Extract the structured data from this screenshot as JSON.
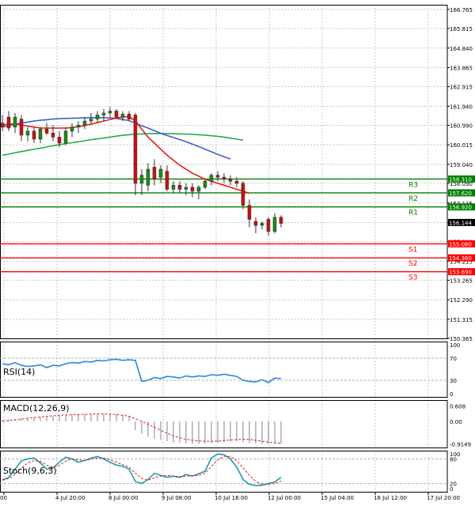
{
  "chart_data": [
    {
      "type": "candlestick",
      "panel": "price",
      "x_tick_labels": [
        "00",
        "4 Jul 20:00",
        "8 Jul 00:00",
        "9 Jul 08:00",
        "10 Jul 16:00",
        "12 Jul 00:00",
        "15 Jul 04:00",
        "16 Jul 12:00",
        "17 Jul 20:00"
      ],
      "y_tick_labels": [
        "166.765",
        "165.815",
        "164.840",
        "163.865",
        "162.915",
        "161.940",
        "160.990",
        "160.015",
        "159.040",
        "158.090",
        "157.115",
        "156.140",
        "155.190",
        "154.215",
        "153.265",
        "152.290",
        "151.315",
        "150.365"
      ],
      "ylim": [
        150.365,
        167.0
      ],
      "current_price": "156.144",
      "candles": [
        {
          "o": 161.1,
          "h": 161.5,
          "l": 160.7,
          "c": 160.9
        },
        {
          "o": 161.4,
          "h": 161.7,
          "l": 160.7,
          "c": 160.85
        },
        {
          "o": 160.9,
          "h": 161.6,
          "l": 160.6,
          "c": 161.4
        },
        {
          "o": 161.3,
          "h": 161.5,
          "l": 160.2,
          "c": 160.5
        },
        {
          "o": 160.5,
          "h": 160.9,
          "l": 160.2,
          "c": 160.7
        },
        {
          "o": 160.7,
          "h": 160.9,
          "l": 160.1,
          "c": 160.3
        },
        {
          "o": 160.3,
          "h": 160.9,
          "l": 160.1,
          "c": 160.8
        },
        {
          "o": 160.8,
          "h": 161.1,
          "l": 160.5,
          "c": 160.6
        },
        {
          "o": 160.6,
          "h": 161.0,
          "l": 160.2,
          "c": 160.4
        },
        {
          "o": 160.4,
          "h": 160.7,
          "l": 159.9,
          "c": 160.1
        },
        {
          "o": 160.1,
          "h": 160.9,
          "l": 160.0,
          "c": 160.7
        },
        {
          "o": 160.7,
          "h": 161.1,
          "l": 160.4,
          "c": 160.9
        },
        {
          "o": 160.9,
          "h": 161.2,
          "l": 160.6,
          "c": 161.0
        },
        {
          "o": 161.0,
          "h": 161.4,
          "l": 160.8,
          "c": 161.2
        },
        {
          "o": 161.2,
          "h": 161.6,
          "l": 161.0,
          "c": 161.3
        },
        {
          "o": 161.3,
          "h": 161.7,
          "l": 161.1,
          "c": 161.5
        },
        {
          "o": 161.5,
          "h": 161.8,
          "l": 161.2,
          "c": 161.6
        },
        {
          "o": 161.6,
          "h": 161.9,
          "l": 161.4,
          "c": 161.7
        },
        {
          "o": 161.7,
          "h": 161.8,
          "l": 161.3,
          "c": 161.4
        },
        {
          "o": 161.4,
          "h": 161.7,
          "l": 161.2,
          "c": 161.55
        },
        {
          "o": 161.55,
          "h": 161.7,
          "l": 161.2,
          "c": 161.3
        },
        {
          "o": 161.5,
          "h": 161.6,
          "l": 157.5,
          "c": 158.1
        },
        {
          "o": 158.1,
          "h": 158.8,
          "l": 157.5,
          "c": 158.5
        },
        {
          "o": 158.0,
          "h": 159.1,
          "l": 157.7,
          "c": 158.8
        },
        {
          "o": 158.9,
          "h": 159.3,
          "l": 158.0,
          "c": 158.3
        },
        {
          "o": 158.4,
          "h": 159.0,
          "l": 158.1,
          "c": 158.8
        },
        {
          "o": 158.7,
          "h": 159.0,
          "l": 157.7,
          "c": 157.8
        },
        {
          "o": 157.8,
          "h": 158.2,
          "l": 157.6,
          "c": 158.0
        },
        {
          "o": 158.0,
          "h": 158.2,
          "l": 157.6,
          "c": 157.8
        },
        {
          "o": 157.8,
          "h": 158.1,
          "l": 157.5,
          "c": 157.9
        },
        {
          "o": 157.9,
          "h": 158.1,
          "l": 157.4,
          "c": 157.7
        },
        {
          "o": 157.7,
          "h": 158.0,
          "l": 157.3,
          "c": 157.9
        },
        {
          "o": 157.9,
          "h": 158.3,
          "l": 157.8,
          "c": 158.2
        },
        {
          "o": 158.2,
          "h": 158.6,
          "l": 158.0,
          "c": 158.5
        },
        {
          "o": 158.5,
          "h": 158.7,
          "l": 158.2,
          "c": 158.4
        },
        {
          "o": 158.4,
          "h": 158.6,
          "l": 158.1,
          "c": 158.3
        },
        {
          "o": 158.3,
          "h": 158.5,
          "l": 158.0,
          "c": 158.2
        },
        {
          "o": 158.2,
          "h": 158.4,
          "l": 157.9,
          "c": 158.1
        },
        {
          "o": 158.1,
          "h": 158.2,
          "l": 156.8,
          "c": 157.0
        },
        {
          "o": 157.0,
          "h": 157.3,
          "l": 155.9,
          "c": 156.3
        },
        {
          "o": 156.2,
          "h": 156.4,
          "l": 155.6,
          "c": 156.0
        },
        {
          "o": 156.0,
          "h": 156.2,
          "l": 155.8,
          "c": 156.1
        },
        {
          "o": 156.3,
          "h": 156.4,
          "l": 155.5,
          "c": 155.7
        },
        {
          "o": 155.7,
          "h": 156.6,
          "l": 155.6,
          "c": 156.4
        },
        {
          "o": 156.4,
          "h": 156.5,
          "l": 155.9,
          "c": 156.1
        }
      ],
      "ma_red": [
        161.0,
        161.05,
        161.05,
        161.0,
        160.95,
        160.9,
        160.85,
        160.85,
        160.85,
        160.85,
        160.85,
        160.88,
        160.92,
        160.98,
        161.05,
        161.12,
        161.2,
        161.28,
        161.35,
        161.4,
        161.42,
        161.2,
        160.8,
        160.4,
        160.1,
        159.8,
        159.5,
        159.25,
        159.0,
        158.8,
        158.6,
        158.45,
        158.3,
        158.2,
        158.1,
        158.0,
        157.9,
        157.8,
        157.7,
        157.6
      ],
      "ma_blue": [
        160.9,
        160.97,
        161.04,
        161.1,
        161.15,
        161.2,
        161.24,
        161.27,
        161.3,
        161.32,
        161.33,
        161.34,
        161.35,
        161.36,
        161.37,
        161.37,
        161.37,
        161.36,
        161.33,
        161.28,
        161.22,
        161.1,
        160.97,
        160.85,
        160.72,
        160.59,
        160.48,
        160.38,
        160.28,
        160.17,
        160.05,
        159.93,
        159.8,
        159.67,
        159.54,
        159.42,
        159.31
      ],
      "ma_green": [
        159.5,
        159.55,
        159.62,
        159.68,
        159.74,
        159.8,
        159.85,
        159.91,
        159.97,
        160.02,
        160.08,
        160.12,
        160.17,
        160.22,
        160.27,
        160.31,
        160.36,
        160.4,
        160.45,
        160.49,
        160.52,
        160.55,
        160.56,
        160.57,
        160.58,
        160.58,
        160.58,
        160.57,
        160.56,
        160.55,
        160.54,
        160.52,
        160.5,
        160.47,
        160.44,
        160.4,
        160.35,
        160.3,
        160.25
      ],
      "levels": [
        {
          "label": "R3",
          "value": 158.31,
          "price_tag": "158.310",
          "color": "#008000"
        },
        {
          "label": "R2",
          "value": 157.62,
          "price_tag": "157.620",
          "color": "#008000"
        },
        {
          "label": "R1",
          "value": 156.92,
          "price_tag": "156.920",
          "color": "#008000"
        },
        {
          "label": "S1",
          "value": 155.08,
          "price_tag": "155.080",
          "color": "#ff0000"
        },
        {
          "label": "S2",
          "value": 154.38,
          "price_tag": "154.380",
          "color": "#ff0000"
        },
        {
          "label": "S3",
          "value": 153.69,
          "price_tag": "153.690",
          "color": "#ff0000"
        }
      ]
    },
    {
      "type": "line",
      "panel": "rsi",
      "name": "RSI(14)",
      "y_tick_labels": [
        "100",
        "70",
        "30",
        "0"
      ],
      "ylim": [
        0,
        100
      ],
      "guides": [
        70,
        30
      ],
      "values": [
        60,
        58,
        62,
        57,
        55,
        56,
        58,
        53,
        57,
        56,
        60,
        62,
        61,
        64,
        63,
        66,
        65,
        67,
        68,
        66,
        67,
        66,
        28,
        30,
        35,
        33,
        37,
        36,
        34,
        38,
        36,
        38,
        37,
        40,
        39,
        41,
        39,
        37,
        30,
        28,
        27,
        31,
        26,
        34,
        33
      ]
    },
    {
      "type": "histogram+line",
      "panel": "macd",
      "name": "MACD(12,26,9)",
      "y_tick_labels": [
        "0.608",
        "0.00",
        "-0.9149"
      ],
      "ylim": [
        -1.05,
        0.85
      ],
      "bars": [
        0.05,
        0.06,
        0.08,
        0.1,
        0.12,
        0.14,
        0.16,
        0.18,
        0.2,
        0.22,
        0.24,
        0.26,
        0.27,
        0.28,
        0.29,
        0.3,
        0.3,
        0.3,
        0.28,
        0.26,
        0.22,
        -0.35,
        -0.5,
        -0.62,
        -0.7,
        -0.76,
        -0.8,
        -0.84,
        -0.86,
        -0.88,
        -0.9,
        -0.91,
        -0.9,
        -0.88,
        -0.86,
        -0.84,
        -0.82,
        -0.8,
        -0.85,
        -0.88,
        -0.9,
        -0.91,
        -0.92,
        -0.91,
        -0.9
      ],
      "signal": [
        0.0,
        0.03,
        0.06,
        0.09,
        0.12,
        0.15,
        0.17,
        0.2,
        0.22,
        0.24,
        0.25,
        0.26,
        0.27,
        0.28,
        0.29,
        0.3,
        0.3,
        0.29,
        0.27,
        0.24,
        0.2,
        0.1,
        0.0,
        -0.12,
        -0.24,
        -0.36,
        -0.48,
        -0.58,
        -0.66,
        -0.72,
        -0.76,
        -0.79,
        -0.8,
        -0.8,
        -0.79,
        -0.77,
        -0.75,
        -0.73,
        -0.72,
        -0.73,
        -0.76,
        -0.8,
        -0.83,
        -0.86,
        -0.88
      ]
    },
    {
      "type": "line",
      "panel": "stoch",
      "name": "Stoch(9,6,3)",
      "y_tick_labels": [
        "100",
        "80",
        "20",
        "0"
      ],
      "ylim": [
        0,
        100
      ],
      "guides": [
        80,
        20
      ],
      "main": [
        28,
        35,
        55,
        75,
        80,
        82,
        70,
        55,
        58,
        72,
        84,
        80,
        72,
        76,
        82,
        86,
        80,
        72,
        65,
        62,
        55,
        25,
        20,
        30,
        45,
        40,
        35,
        38,
        35,
        42,
        38,
        44,
        50,
        82,
        92,
        90,
        80,
        60,
        30,
        18,
        15,
        16,
        20,
        24,
        35
      ],
      "signal": [
        30,
        32,
        42,
        58,
        70,
        76,
        74,
        65,
        60,
        64,
        74,
        80,
        78,
        76,
        79,
        82,
        82,
        78,
        72,
        66,
        60,
        45,
        32,
        28,
        34,
        38,
        40,
        38,
        37,
        38,
        39,
        40,
        45,
        62,
        78,
        86,
        86,
        76,
        58,
        40,
        25,
        18,
        18,
        20,
        26
      ]
    }
  ]
}
